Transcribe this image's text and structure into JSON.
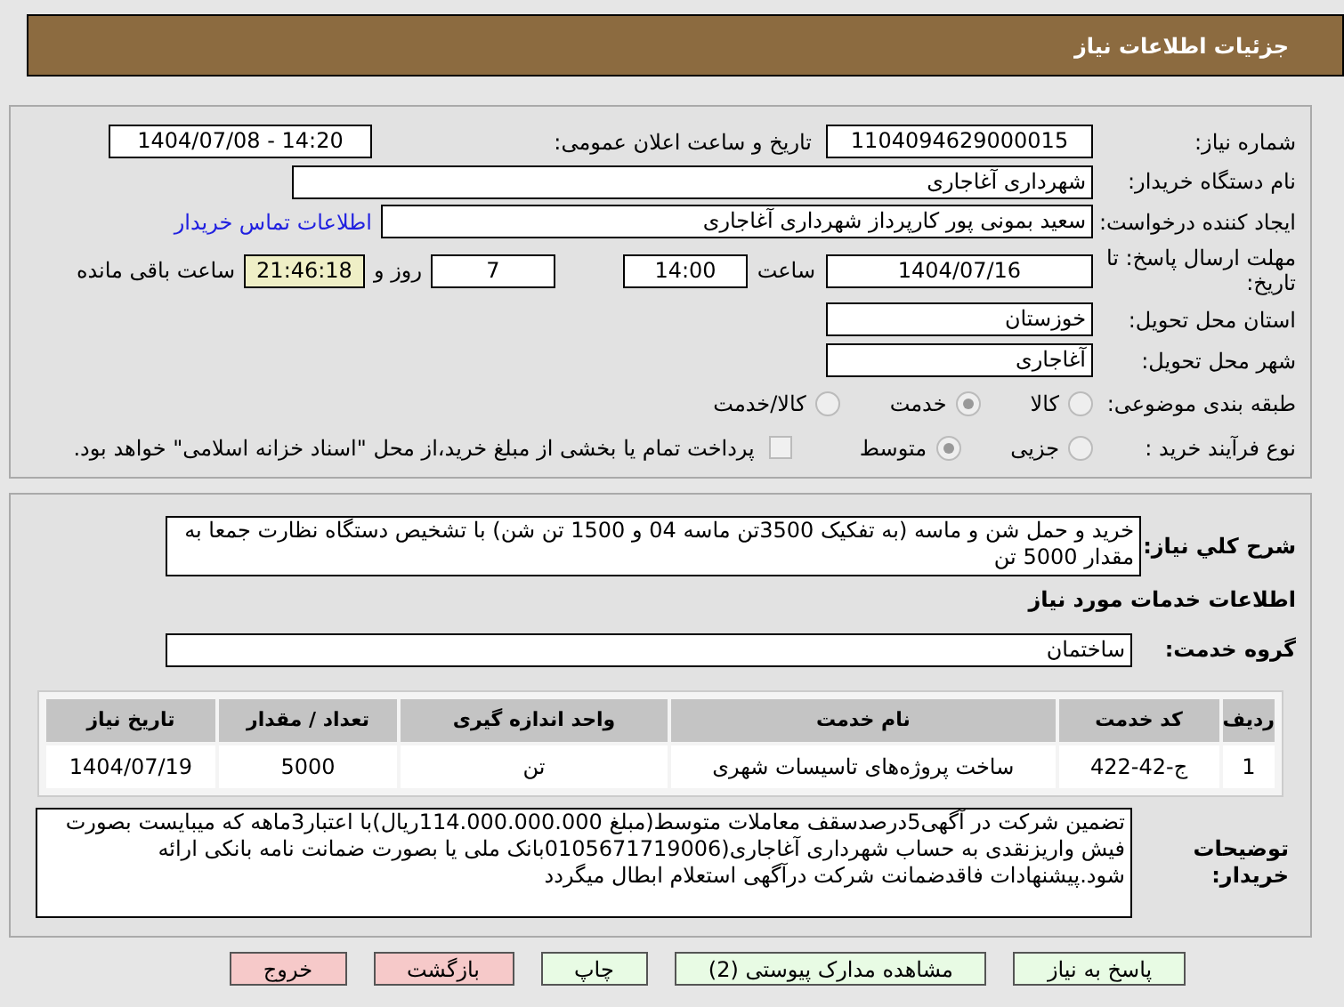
{
  "header": {
    "title": "جزئیات اطلاعات نیاز"
  },
  "need_number": {
    "label": "شماره نیاز:",
    "value": "1104094629000015"
  },
  "announce": {
    "label": "تاریخ و ساعت اعلان عمومی:",
    "value": "1404/07/08 - 14:20"
  },
  "buyer": {
    "label": "نام دستگاه خریدار:",
    "value": "شهرداری آغاجاری"
  },
  "creator": {
    "label": "ایجاد کننده درخواست:",
    "value": "سعید بمونی پور کارپرداز شهرداری آغاجاری",
    "link": "اطلاعات تماس خریدار"
  },
  "deadline": {
    "label": "مهلت ارسال پاسخ: تا تاریخ:",
    "date": "1404/07/16",
    "time_label": "ساعت",
    "time": "14:00",
    "days": "7",
    "days_label": "روز و",
    "remaining": "21:46:18",
    "remaining_label": "ساعت باقی مانده"
  },
  "province": {
    "label": "استان محل تحویل:",
    "value": "خوزستان"
  },
  "city": {
    "label": "شهر محل تحویل:",
    "value": "آغاجاری"
  },
  "category": {
    "label": "طبقه بندی موضوعی:",
    "options": [
      {
        "label": "کالا",
        "selected": false
      },
      {
        "label": "خدمت",
        "selected": true
      },
      {
        "label": "کالا/خدمت",
        "selected": false
      }
    ]
  },
  "purchase_type": {
    "label": "نوع فرآیند خرید :",
    "options": [
      {
        "label": "جزیی",
        "selected": false
      },
      {
        "label": "متوسط",
        "selected": true
      }
    ],
    "treasury": {
      "label": "پرداخت تمام یا بخشی از مبلغ خرید،از محل \"اسناد خزانه اسلامی\" خواهد بود.",
      "checked": false
    }
  },
  "description": {
    "label": "شرح کلي نیاز:",
    "value": "خرید و حمل شن و ماسه (به تفکیک 3500تن ماسه 04 و 1500 تن شن) با تشخیص دستگاه نظارت جمعا به مقدار 5000 تن"
  },
  "services_heading": "اطلاعات خدمات مورد نیاز",
  "service_group": {
    "label": "گروه خدمت:",
    "value": "ساختمان"
  },
  "table": {
    "columns": [
      "ردیف",
      "کد خدمت",
      "نام خدمت",
      "واحد اندازه گیری",
      "تعداد / مقدار",
      "تاریخ نیاز"
    ],
    "rows": [
      [
        "1",
        "ج-42-422",
        "ساخت پروژه‌های تاسیسات شهری",
        "تن",
        "5000",
        "1404/07/19"
      ]
    ]
  },
  "buyer_notes": {
    "label": "توضیحات خریدار:",
    "value": "تضمین شرکت در آگهی5درصدسقف معاملات متوسط(مبلغ 114.000.000.000ریال)با اعتبار3ماهه که میبایست بصورت فیش واریزنقدی به حساب شهرداری آغاجاری(0105671719006بانک ملی یا بصورت ضمانت نامه بانکی ارائه شود.پیشنهادات فاقدضمانت شرکت درآگهی استعلام ابطال میگردد"
  },
  "buttons": [
    {
      "label": "پاسخ به نیاز",
      "kind": "action"
    },
    {
      "label": "مشاهده مدارک پیوستی (2)",
      "kind": "action"
    },
    {
      "label": "چاپ",
      "kind": "action"
    },
    {
      "label": "بازگشت",
      "kind": "exit"
    },
    {
      "label": "خروج",
      "kind": "exit"
    }
  ]
}
